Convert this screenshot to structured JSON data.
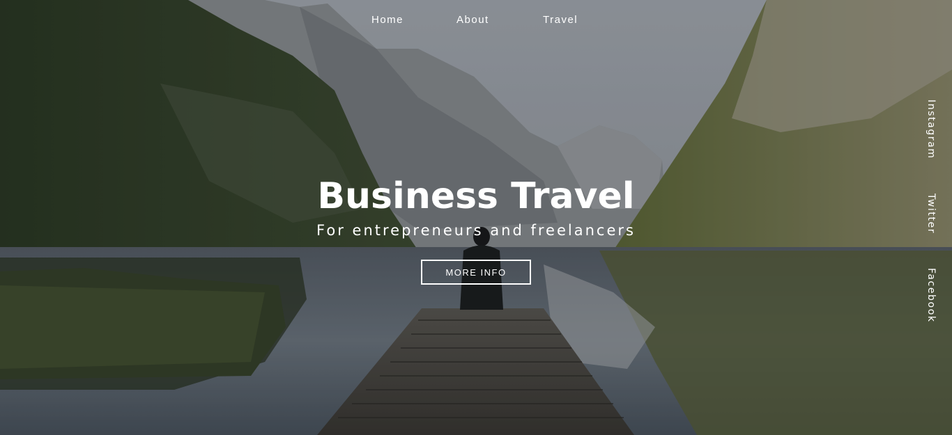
{
  "nav": {
    "items": [
      {
        "label": "Home"
      },
      {
        "label": "About"
      },
      {
        "label": "Travel"
      }
    ]
  },
  "hero": {
    "title": "Business Travel",
    "subtitle": "For entrepreneurs and freelancers",
    "cta_label": "MORE INFO",
    "background_image": "mountain-lake-dock-photo"
  },
  "social": {
    "items": [
      {
        "label": "Instagram"
      },
      {
        "label": "Twitter"
      },
      {
        "label": "Facebook"
      }
    ]
  },
  "colors": {
    "text": "#ffffff",
    "button_border": "#ffffff"
  }
}
